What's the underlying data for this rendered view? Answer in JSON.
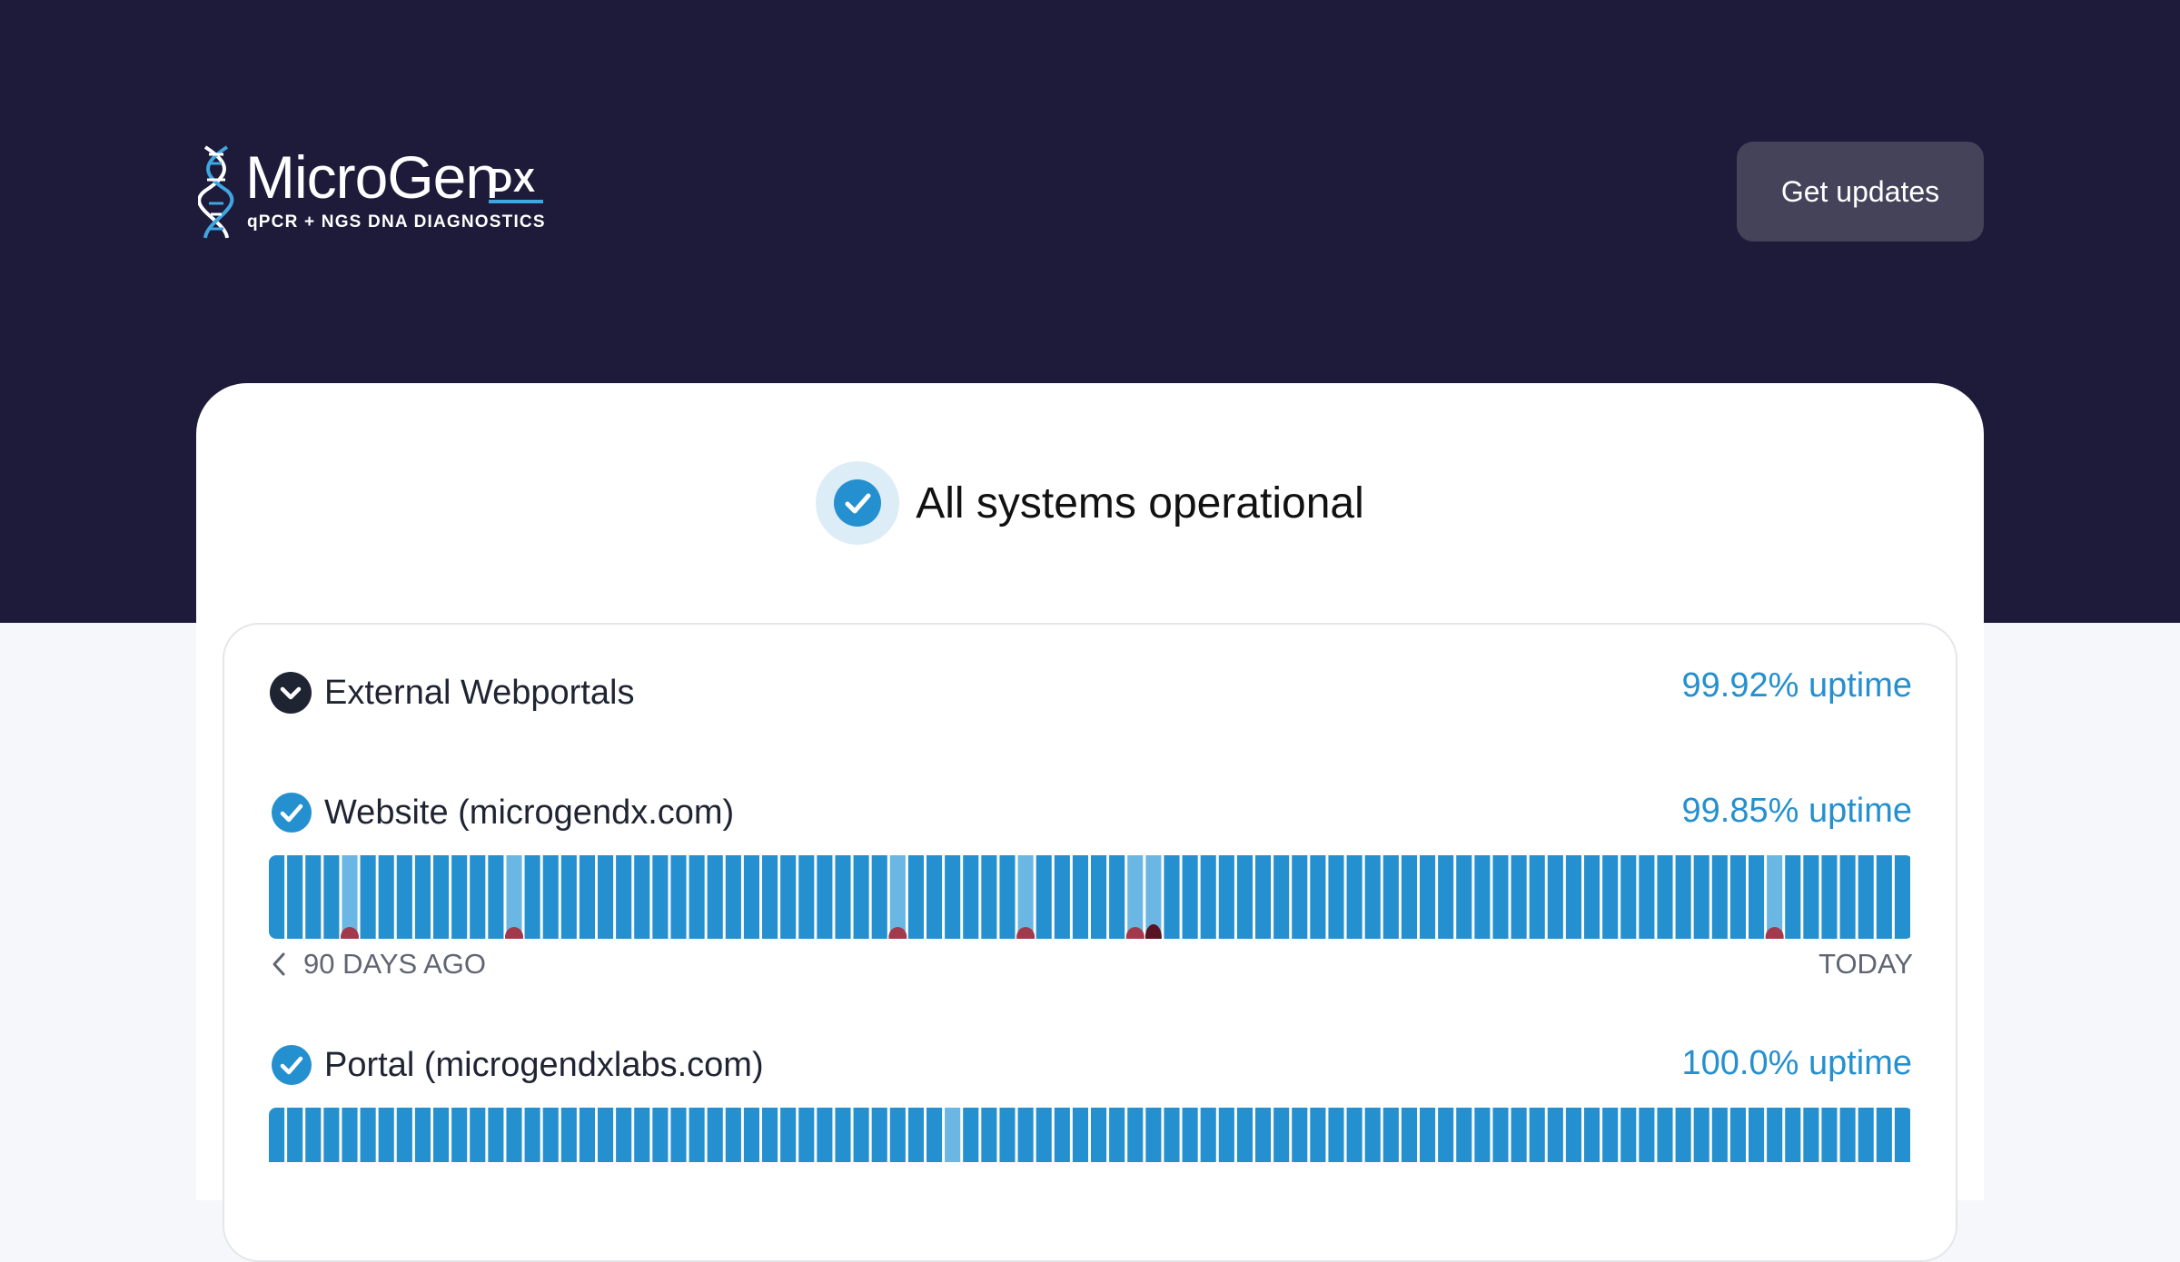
{
  "brand": {
    "name": "MicroGen",
    "suffix": "DX",
    "tagline": "qPCR + NGS DNA DIAGNOSTICS",
    "icon": "dna-helix-icon",
    "colors": {
      "header_bg": "#1e1a3a",
      "accent": "#3fa6e0"
    }
  },
  "header": {
    "get_updates_label": "Get updates"
  },
  "status": {
    "text": "All systems operational",
    "icon": "check-circle-icon",
    "color": "#2590cf"
  },
  "groups": [
    {
      "title": "External Webportals",
      "uptime": "99.92% uptime",
      "icon": "chevron-down-icon",
      "services": [
        {
          "name": "Website (microgendx.com)",
          "uptime": "99.85% uptime",
          "range_start": "90 DAYS AGO",
          "range_end": "TODAY",
          "days": 90,
          "degraded_days": [
            4,
            13,
            34,
            41,
            47,
            48,
            82
          ],
          "incident_days": [
            {
              "day": 4,
              "severity": "minor"
            },
            {
              "day": 13,
              "severity": "minor"
            },
            {
              "day": 34,
              "severity": "minor"
            },
            {
              "day": 41,
              "severity": "minor"
            },
            {
              "day": 47,
              "severity": "minor"
            },
            {
              "day": 48,
              "severity": "major"
            },
            {
              "day": 82,
              "severity": "minor"
            }
          ]
        },
        {
          "name": "Portal (microgendxlabs.com)",
          "uptime": "100.0% uptime",
          "days": 90,
          "degraded_days": [
            37
          ],
          "incident_days": []
        }
      ]
    }
  ],
  "bar_colors": {
    "operational": "#2590cf",
    "degraded": "#6ab7e3",
    "minor": "#a3394d",
    "major": "#5a1323"
  }
}
